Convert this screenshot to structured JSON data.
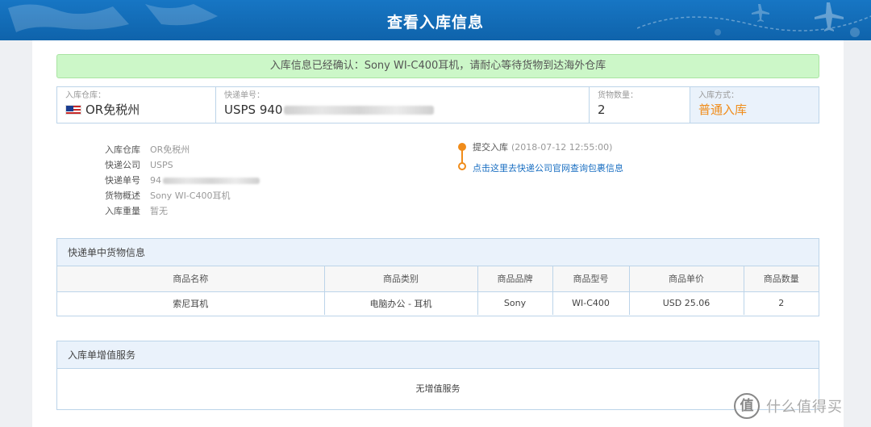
{
  "header": {
    "title": "查看入库信息"
  },
  "notice": {
    "text": "入库信息已经确认：Sony WI-C400耳机，请耐心等待货物到达海外仓库"
  },
  "summary": {
    "warehouse_label": "入库仓库：",
    "warehouse_value": "OR免税州",
    "tracking_label": "快递单号：",
    "tracking_value": "USPS 940",
    "quantity_label": "货物数量：",
    "quantity_value": "2",
    "method_label": "入库方式：",
    "method_value": "普通入库",
    "method_color": "#f08c1a"
  },
  "details": [
    {
      "key": "入库仓库",
      "value": "OR免税州"
    },
    {
      "key": "快递公司",
      "value": "USPS"
    },
    {
      "key": "快递单号",
      "value": "94"
    },
    {
      "key": "货物概述",
      "value": "Sony WI-C400耳机"
    },
    {
      "key": "入库重量",
      "value": "暂无"
    }
  ],
  "timeline": {
    "event": "提交入库",
    "time": "(2018-07-12 12:55:00)",
    "link": "点击这里去快递公司官网查询包裹信息"
  },
  "goods": {
    "title": "快递单中货物信息",
    "columns": [
      "商品名称",
      "商品类别",
      "商品品牌",
      "商品型号",
      "商品单价",
      "商品数量"
    ],
    "rows": [
      [
        "索尼耳机",
        "电脑办公 - 耳机",
        "Sony",
        "WI-C400",
        "USD 25.06",
        "2"
      ]
    ]
  },
  "services": {
    "title": "入库单增值服务",
    "empty": "无增值服务"
  },
  "watermark": {
    "logo": "值",
    "text": "什么值得买"
  }
}
